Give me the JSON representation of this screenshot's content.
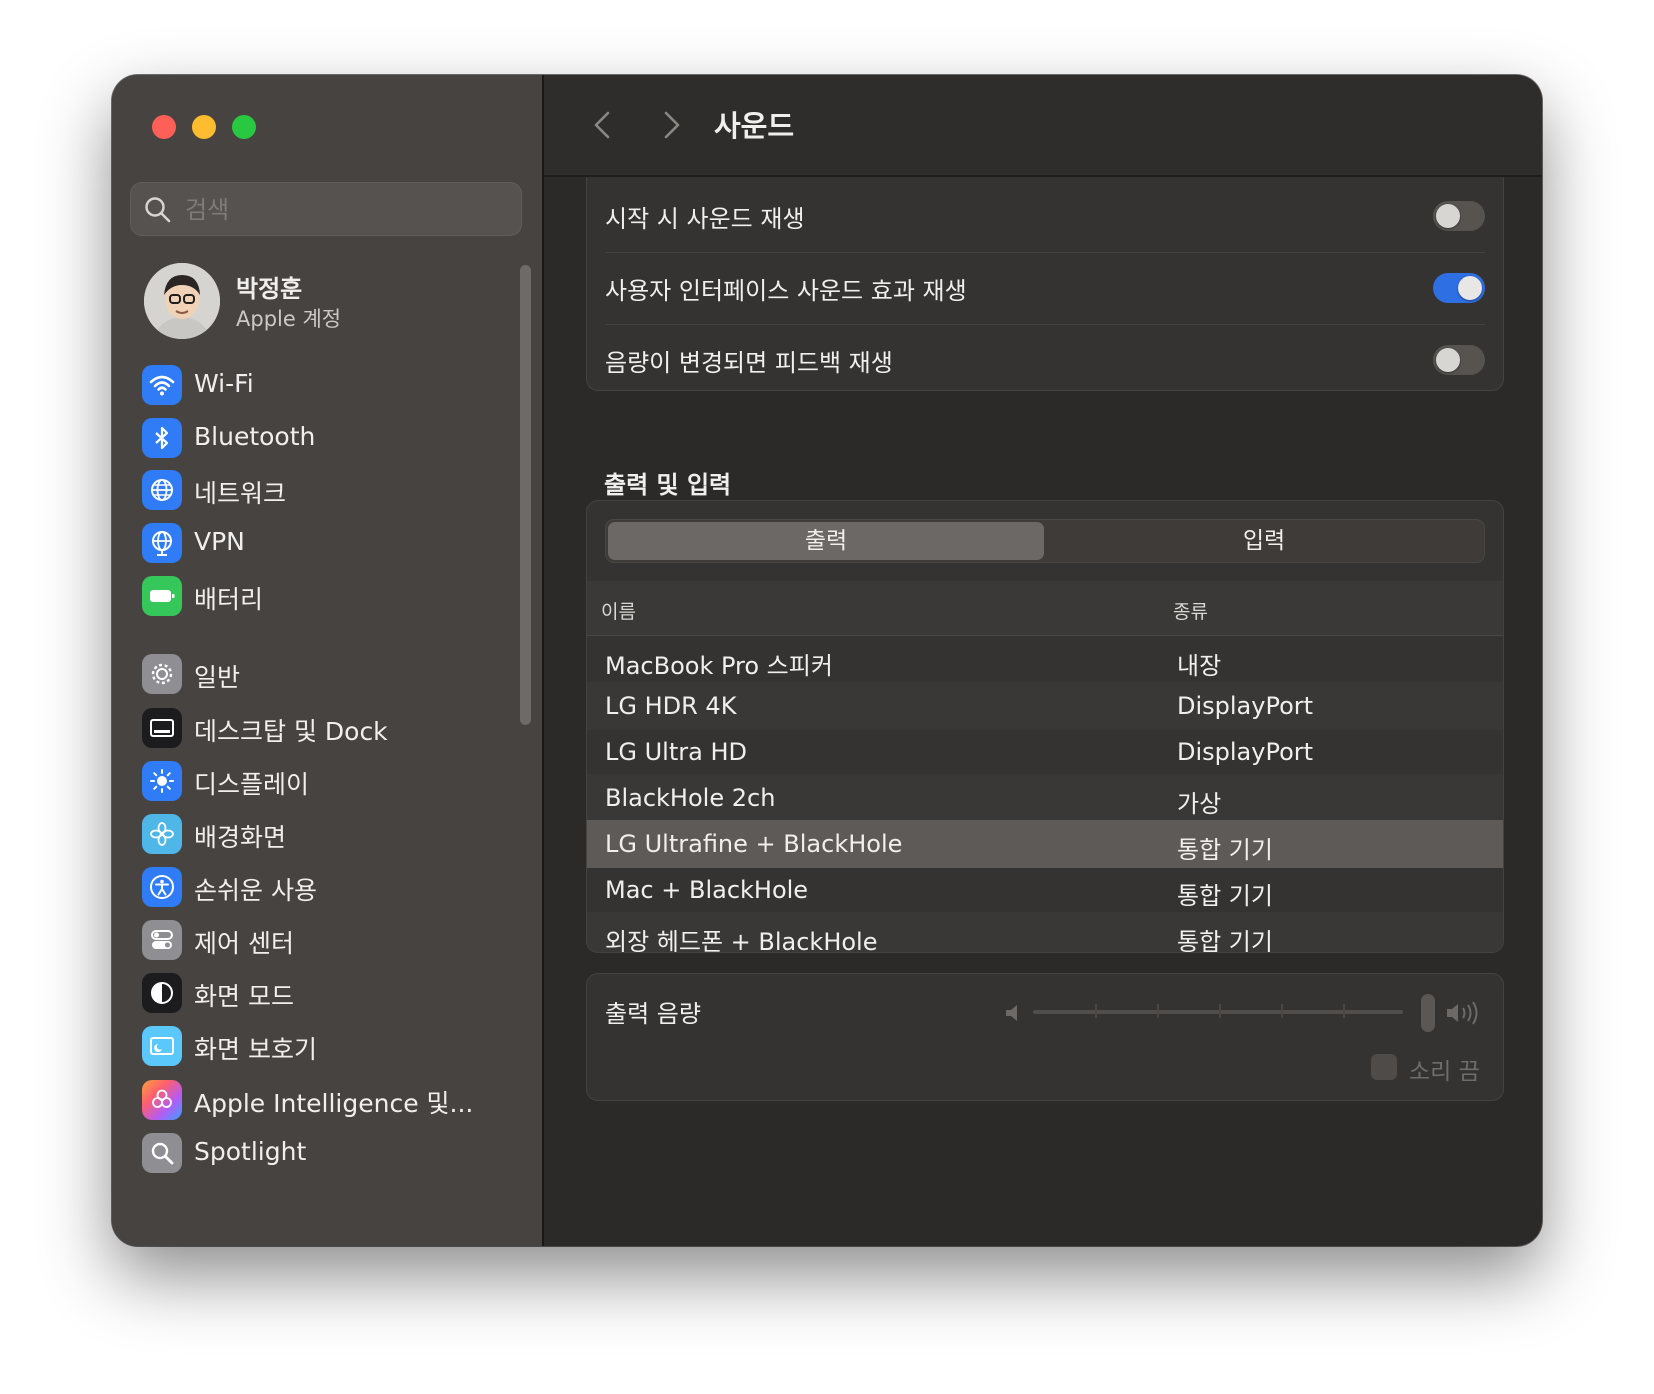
{
  "window": {
    "title": "사운드"
  },
  "search": {
    "placeholder": "검색"
  },
  "account": {
    "name": "박정훈",
    "subtitle": "Apple 계정"
  },
  "sidebar": {
    "items": [
      {
        "label": "Wi-Fi",
        "icon": "wifi-icon",
        "color": "#2f7cf6"
      },
      {
        "label": "Bluetooth",
        "icon": "bluetooth-icon",
        "color": "#2f7cf6"
      },
      {
        "label": "네트워크",
        "icon": "globe-icon",
        "color": "#2f7cf6"
      },
      {
        "label": "VPN",
        "icon": "globe-icon",
        "color": "#2f7cf6"
      },
      {
        "label": "배터리",
        "icon": "battery-icon",
        "color": "#35c759"
      },
      {
        "label": "일반",
        "icon": "gear-icon",
        "color": "#8e8e93"
      },
      {
        "label": "데스크탑 및 Dock",
        "icon": "dock-icon",
        "color": "#1c1c1e"
      },
      {
        "label": "디스플레이",
        "icon": "sun-icon",
        "color": "#2f7cf6"
      },
      {
        "label": "배경화면",
        "icon": "flower-icon",
        "color": "#4fb6e8"
      },
      {
        "label": "손쉬운 사용",
        "icon": "accessibility-icon",
        "color": "#2f7cf6"
      },
      {
        "label": "제어 센터",
        "icon": "toggles-icon",
        "color": "#8e8e93"
      },
      {
        "label": "화면 모드",
        "icon": "appearance-icon",
        "color": "#1c1c1e"
      },
      {
        "label": "화면 보호기",
        "icon": "screensaver-icon",
        "color": "#5ac8fa"
      },
      {
        "label": "Apple Intelligence 및...",
        "icon": "intelligence-icon",
        "color": "#ff6b6b"
      },
      {
        "label": "Spotlight",
        "icon": "magnifier-icon",
        "color": "#8e8e93"
      }
    ]
  },
  "settings": {
    "toggles": [
      {
        "label": "시작 시 사운드 재생",
        "on": false
      },
      {
        "label": "사용자 인터페이스 사운드 효과 재생",
        "on": true
      },
      {
        "label": "음량이 변경되면 피드백 재생",
        "on": false
      }
    ]
  },
  "io": {
    "section_title": "출력 및 입력",
    "tabs": {
      "output": "출력",
      "input": "입력",
      "selected": "출력"
    },
    "columns": {
      "name": "이름",
      "type": "종류"
    },
    "devices": [
      {
        "name": "MacBook Pro 스피커",
        "type": "내장"
      },
      {
        "name": "LG HDR 4K",
        "type": "DisplayPort"
      },
      {
        "name": "LG Ultra HD",
        "type": "DisplayPort"
      },
      {
        "name": "BlackHole 2ch",
        "type": "가상"
      },
      {
        "name": "LG Ultrafine + BlackHole",
        "type": "통합 기기",
        "selected": true
      },
      {
        "name": "Mac + BlackHole",
        "type": "통합 기기"
      },
      {
        "name": "외장 헤드폰 + BlackHole",
        "type": "통합 기기"
      }
    ]
  },
  "volume": {
    "label": "출력 음량",
    "level": 1.0,
    "mute_label": "소리 끔",
    "muted": false
  },
  "help": {
    "label": "?"
  },
  "colors": {
    "accent": "#2e6fe3",
    "close": "#fe5f57",
    "minimize": "#febc2e",
    "maximize": "#28c840"
  }
}
